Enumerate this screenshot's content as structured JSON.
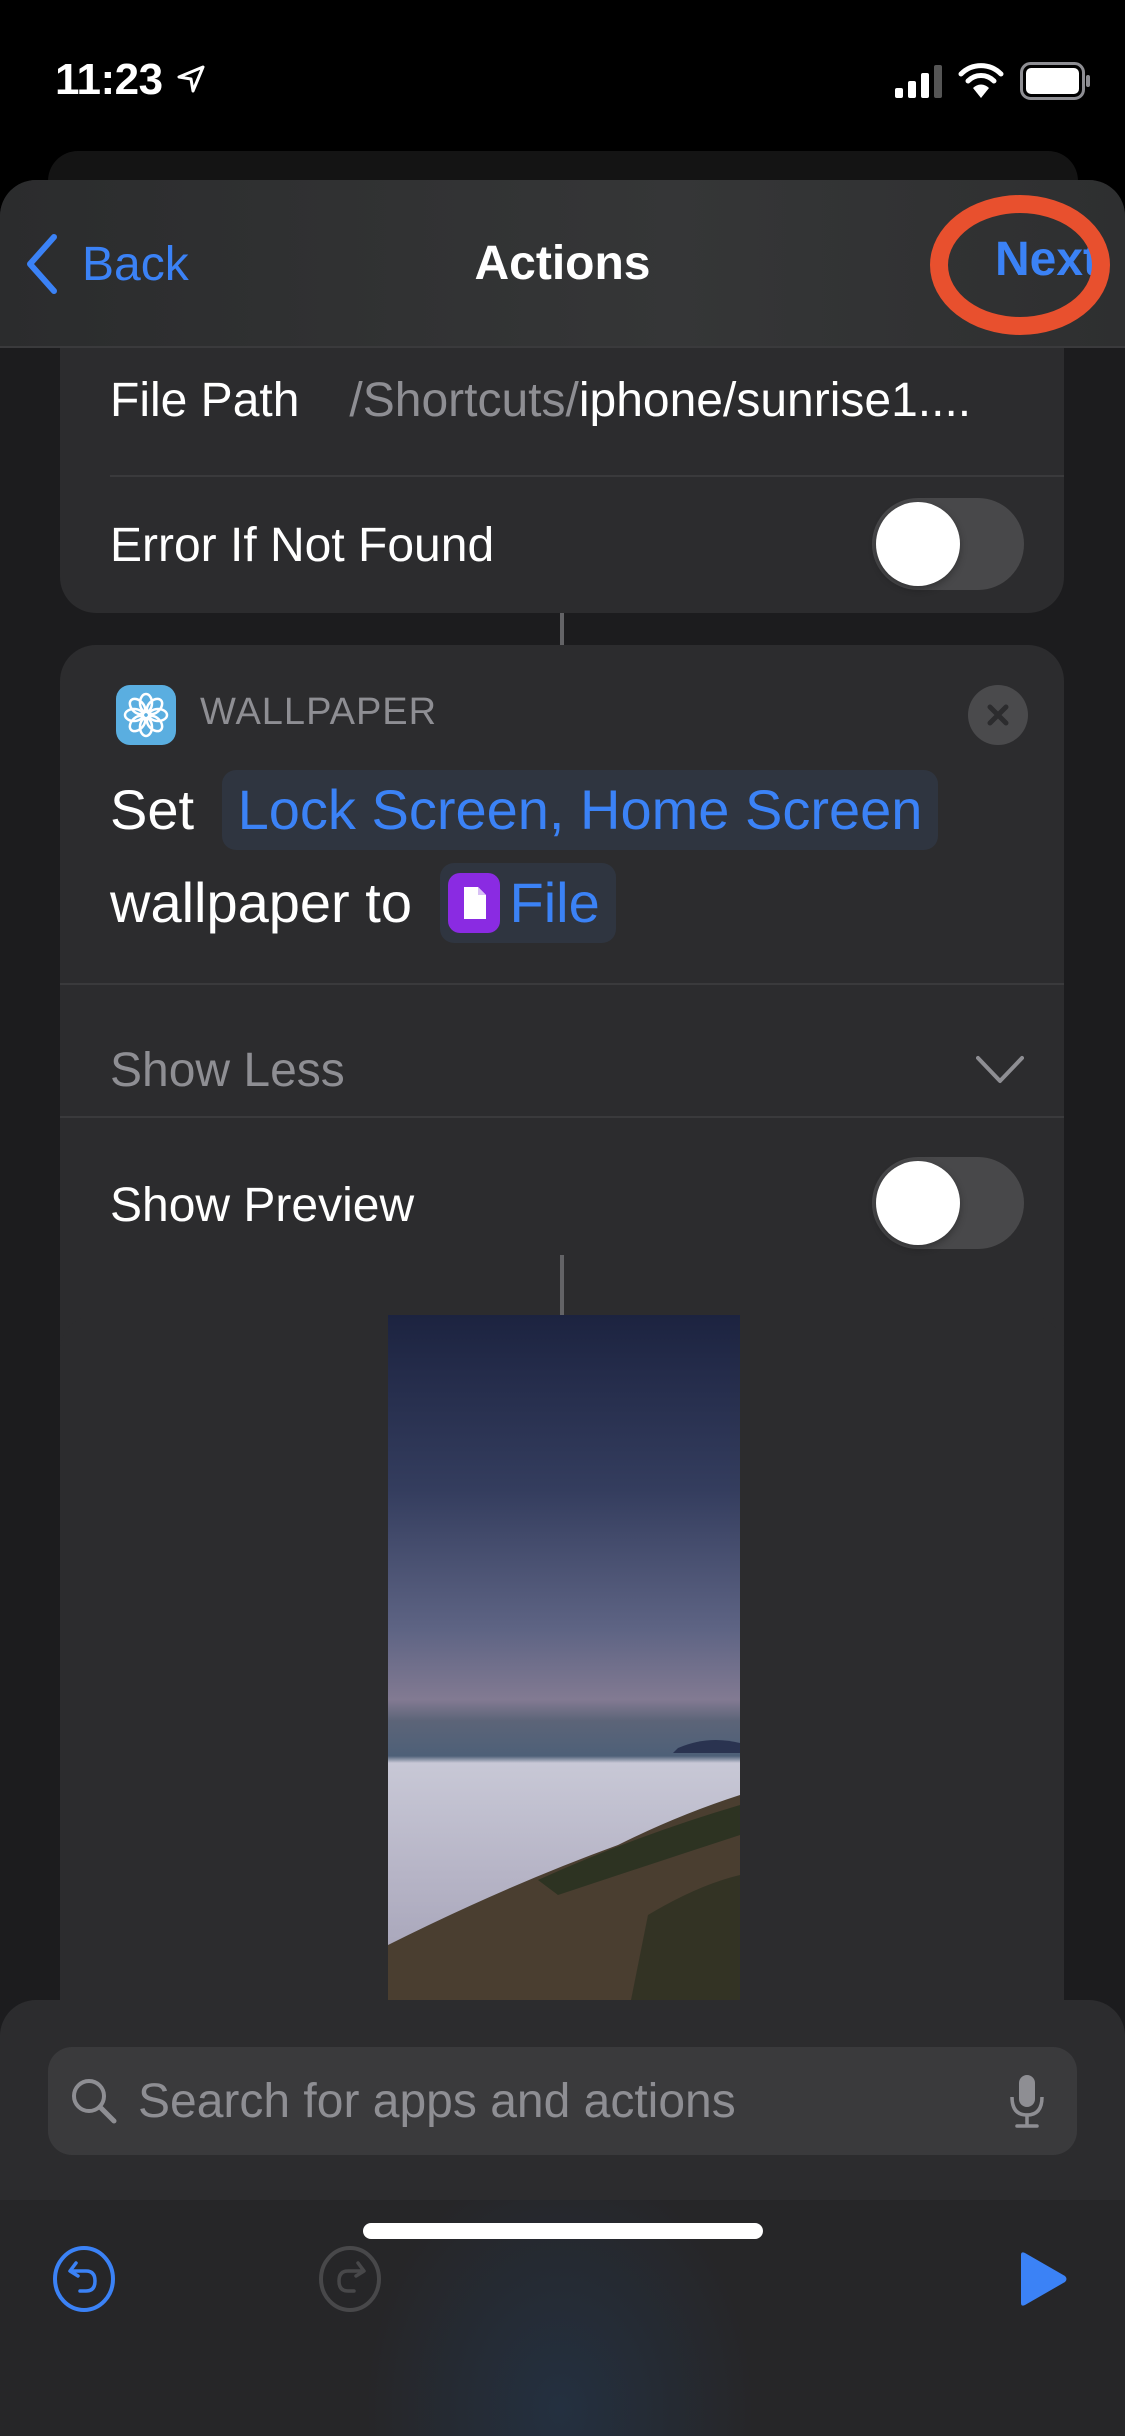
{
  "status_bar": {
    "time": "11:23"
  },
  "nav": {
    "back_label": "Back",
    "title": "Actions",
    "next_label": "Next",
    "highlight_color": "#e8502e"
  },
  "file_card": {
    "file_path_label": "File Path",
    "file_path_prefix": "/Shortcuts/",
    "file_path_value": "iphone/sunrise1....",
    "error_label": "Error If Not Found",
    "error_toggle_on": false
  },
  "wallpaper_card": {
    "category": "WALLPAPER",
    "set_word": "Set",
    "target_token": "Lock Screen, Home Screen",
    "middle_text": "wallpaper to",
    "file_token": "File",
    "show_less_label": "Show Less",
    "show_preview_label": "Show Preview",
    "show_preview_on": false
  },
  "search": {
    "placeholder": "Search for apps and actions",
    "value": ""
  },
  "colors": {
    "accent": "#3b82f6",
    "wallpaper_icon_bg": "#5aaee0",
    "file_icon_bg": "#8a2be2"
  }
}
